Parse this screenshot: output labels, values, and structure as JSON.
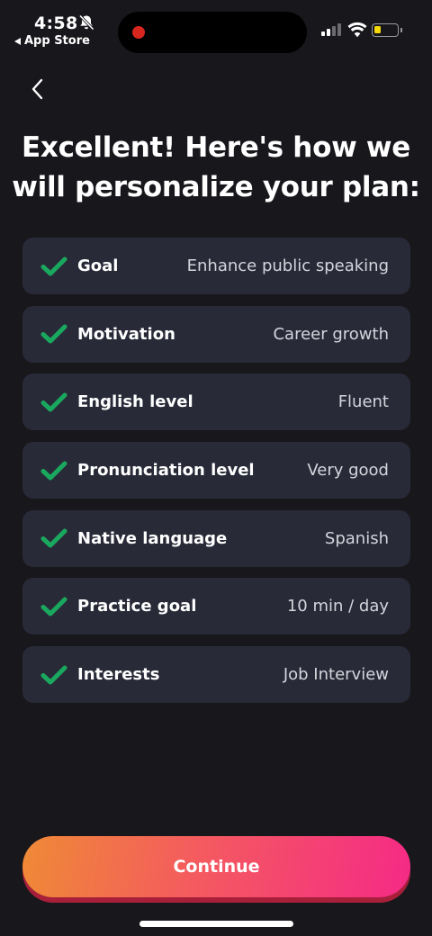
{
  "status_bar": {
    "time": "4:58",
    "back_app": "App Store",
    "icons": [
      "bell-off-icon",
      "signal-icon",
      "wifi-icon",
      "battery-icon"
    ],
    "battery_level_fraction": 0.3,
    "battery_color": "#f5d90a",
    "recording_color": "#d7261e"
  },
  "nav": {
    "back_icon": "chevron-left-icon"
  },
  "title_line1": "Excellent! Here's how we",
  "title_line2": "will personalize your plan:",
  "check_color": "#1aa85e",
  "plan_items": [
    {
      "label": "Goal",
      "value": "Enhance public speaking"
    },
    {
      "label": "Motivation",
      "value": "Career growth"
    },
    {
      "label": "English level",
      "value": "Fluent"
    },
    {
      "label": "Pronunciation level",
      "value": "Very good"
    },
    {
      "label": "Native language",
      "value": "Spanish"
    },
    {
      "label": "Practice goal",
      "value": "10 min / day"
    },
    {
      "label": "Interests",
      "value": "Job Interview"
    }
  ],
  "continue_label": "Continue",
  "colors": {
    "background": "#18171c",
    "card": "#282a38",
    "button_gradient": [
      "#ef8a36",
      "#f45a5f",
      "#f52a86"
    ]
  }
}
